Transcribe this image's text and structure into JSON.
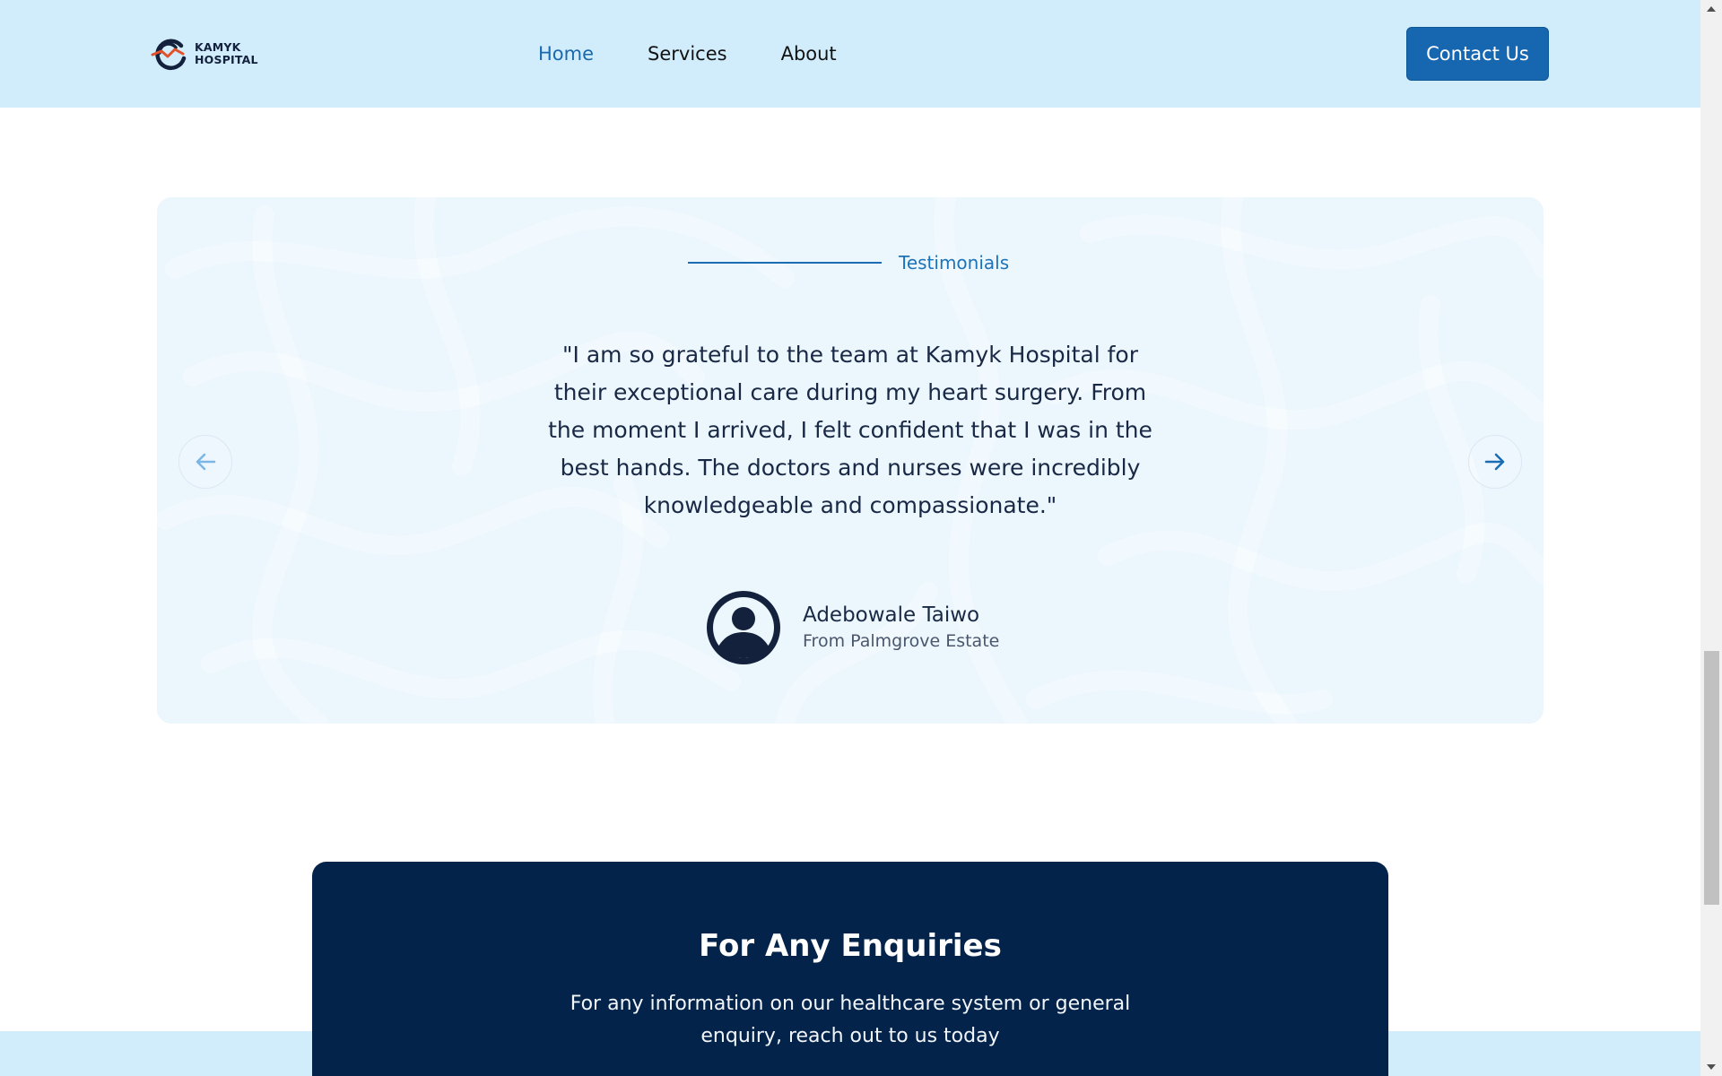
{
  "header": {
    "logo": {
      "line1": "KAMYK",
      "line2": "HOSPITAL",
      "icon": "kamyk-logo-icon"
    },
    "nav": [
      {
        "label": "Home",
        "active": true
      },
      {
        "label": "Services",
        "active": false
      },
      {
        "label": "About",
        "active": false
      }
    ],
    "contact_label": "Contact Us"
  },
  "testimonials": {
    "section_label": "Testimonials",
    "quote": "\"I am so grateful to the team at Kamyk Hospital for their exceptional care during my heart surgery. From the moment I arrived, I felt confident that I was in the best hands. The doctors and nurses were incredibly knowledgeable and compassionate.\"",
    "author": {
      "name": "Adebowale Taiwo",
      "location": "From Palmgrove Estate",
      "avatar_icon": "user-avatar-icon"
    },
    "prev_icon": "arrow-left-icon",
    "next_icon": "arrow-right-icon"
  },
  "enquiries": {
    "title": "For Any Enquiries",
    "text": "For any information on our healthcare system or general enquiry, reach out to us today"
  },
  "colors": {
    "header_bg": "#d1edfc",
    "brand_blue": "#1666b0",
    "navy": "#03234a",
    "active_nav": "#1a69ad",
    "logo_accent": "#e2512b"
  }
}
